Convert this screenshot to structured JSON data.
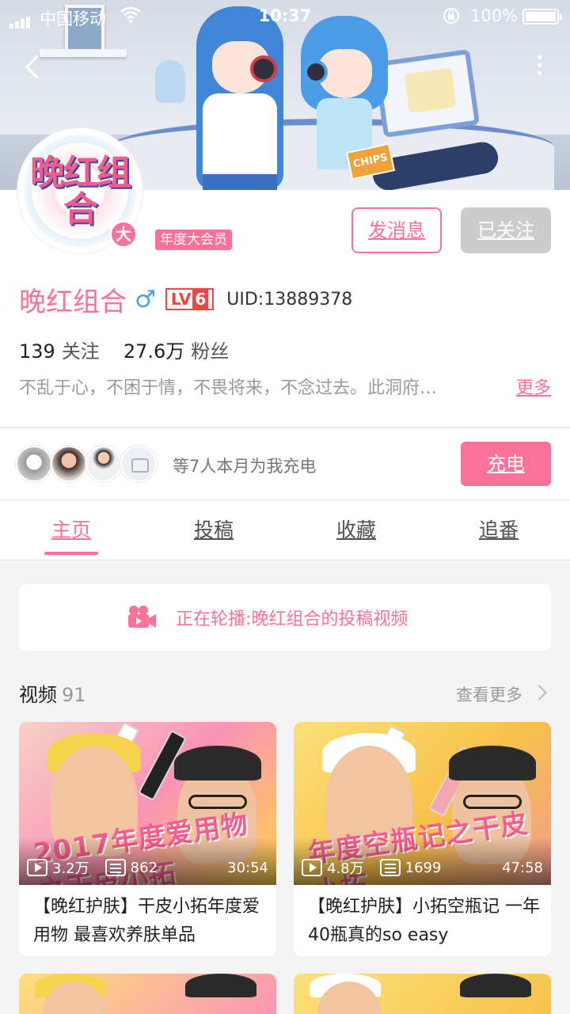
{
  "status_bar": {
    "carrier": "中国移动",
    "time": "10:37",
    "battery": "100%"
  },
  "profile": {
    "name": "晚红组合",
    "gender_symbol": "♂",
    "level_prefix": "LV",
    "level": "6",
    "uid": "UID:13889378",
    "vip_tag": "年度大会员",
    "vip_mark": "大",
    "avatar_logo_text": "晚红组合",
    "following_count": "139",
    "following_label": "关注",
    "fans_count": "27.6万",
    "fans_label": "粉丝",
    "bio": "不乱于心，不困于情，不畏将来，不念过去。此洞府…",
    "bio_more": "更多",
    "message_button": "发消息",
    "followed_button": "已关注"
  },
  "charge": {
    "text": "等7人本月为我充电",
    "button": "充电"
  },
  "tabs": [
    {
      "label": "主页",
      "active": true
    },
    {
      "label": "投稿",
      "active": false
    },
    {
      "label": "收藏",
      "active": false
    },
    {
      "label": "追番",
      "active": false
    }
  ],
  "playing_bar": {
    "text": "正在轮播:晚红组合的投稿视频"
  },
  "videos_section": {
    "title": "视频",
    "count": "91",
    "more": "查看更多"
  },
  "videos": [
    {
      "title": "【晚红护肤】干皮小拓年度爱用物 最喜欢养肤单品",
      "plays": "3.2万",
      "danmaku": "862",
      "duration": "30:54",
      "thumb_text": "2017年度爱用物之干皮小拓"
    },
    {
      "title": "【晚红护肤】小拓空瓶记 一年40瓶真的so easy",
      "plays": "4.8万",
      "danmaku": "1699",
      "duration": "47:58",
      "thumb_text": "年度空瓶记之干皮小拓"
    }
  ],
  "banner": {
    "chips_label": "CHIPS"
  },
  "colors": {
    "accent": "#fb7299",
    "level_red": "#f04444",
    "gender_blue": "#4ba0e8",
    "followed_gray": "#cccccc"
  }
}
